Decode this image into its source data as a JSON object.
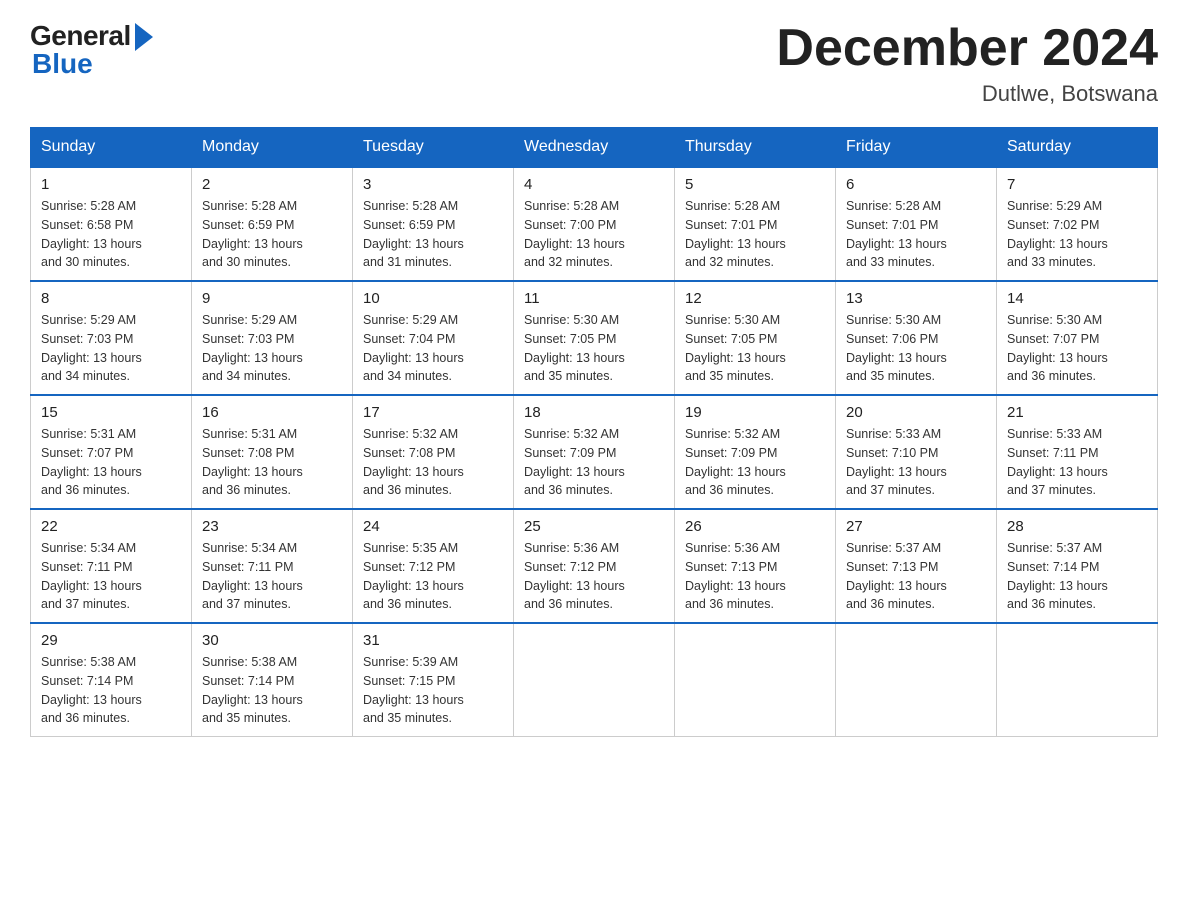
{
  "header": {
    "logo": {
      "general_text": "General",
      "blue_text": "Blue"
    },
    "title": "December 2024",
    "location": "Dutlwe, Botswana"
  },
  "days_of_week": [
    "Sunday",
    "Monday",
    "Tuesday",
    "Wednesday",
    "Thursday",
    "Friday",
    "Saturday"
  ],
  "weeks": [
    [
      {
        "day": "1",
        "sunrise": "5:28 AM",
        "sunset": "6:58 PM",
        "daylight": "13 hours and 30 minutes."
      },
      {
        "day": "2",
        "sunrise": "5:28 AM",
        "sunset": "6:59 PM",
        "daylight": "13 hours and 30 minutes."
      },
      {
        "day": "3",
        "sunrise": "5:28 AM",
        "sunset": "6:59 PM",
        "daylight": "13 hours and 31 minutes."
      },
      {
        "day": "4",
        "sunrise": "5:28 AM",
        "sunset": "7:00 PM",
        "daylight": "13 hours and 32 minutes."
      },
      {
        "day": "5",
        "sunrise": "5:28 AM",
        "sunset": "7:01 PM",
        "daylight": "13 hours and 32 minutes."
      },
      {
        "day": "6",
        "sunrise": "5:28 AM",
        "sunset": "7:01 PM",
        "daylight": "13 hours and 33 minutes."
      },
      {
        "day": "7",
        "sunrise": "5:29 AM",
        "sunset": "7:02 PM",
        "daylight": "13 hours and 33 minutes."
      }
    ],
    [
      {
        "day": "8",
        "sunrise": "5:29 AM",
        "sunset": "7:03 PM",
        "daylight": "13 hours and 34 minutes."
      },
      {
        "day": "9",
        "sunrise": "5:29 AM",
        "sunset": "7:03 PM",
        "daylight": "13 hours and 34 minutes."
      },
      {
        "day": "10",
        "sunrise": "5:29 AM",
        "sunset": "7:04 PM",
        "daylight": "13 hours and 34 minutes."
      },
      {
        "day": "11",
        "sunrise": "5:30 AM",
        "sunset": "7:05 PM",
        "daylight": "13 hours and 35 minutes."
      },
      {
        "day": "12",
        "sunrise": "5:30 AM",
        "sunset": "7:05 PM",
        "daylight": "13 hours and 35 minutes."
      },
      {
        "day": "13",
        "sunrise": "5:30 AM",
        "sunset": "7:06 PM",
        "daylight": "13 hours and 35 minutes."
      },
      {
        "day": "14",
        "sunrise": "5:30 AM",
        "sunset": "7:07 PM",
        "daylight": "13 hours and 36 minutes."
      }
    ],
    [
      {
        "day": "15",
        "sunrise": "5:31 AM",
        "sunset": "7:07 PM",
        "daylight": "13 hours and 36 minutes."
      },
      {
        "day": "16",
        "sunrise": "5:31 AM",
        "sunset": "7:08 PM",
        "daylight": "13 hours and 36 minutes."
      },
      {
        "day": "17",
        "sunrise": "5:32 AM",
        "sunset": "7:08 PM",
        "daylight": "13 hours and 36 minutes."
      },
      {
        "day": "18",
        "sunrise": "5:32 AM",
        "sunset": "7:09 PM",
        "daylight": "13 hours and 36 minutes."
      },
      {
        "day": "19",
        "sunrise": "5:32 AM",
        "sunset": "7:09 PM",
        "daylight": "13 hours and 36 minutes."
      },
      {
        "day": "20",
        "sunrise": "5:33 AM",
        "sunset": "7:10 PM",
        "daylight": "13 hours and 37 minutes."
      },
      {
        "day": "21",
        "sunrise": "5:33 AM",
        "sunset": "7:11 PM",
        "daylight": "13 hours and 37 minutes."
      }
    ],
    [
      {
        "day": "22",
        "sunrise": "5:34 AM",
        "sunset": "7:11 PM",
        "daylight": "13 hours and 37 minutes."
      },
      {
        "day": "23",
        "sunrise": "5:34 AM",
        "sunset": "7:11 PM",
        "daylight": "13 hours and 37 minutes."
      },
      {
        "day": "24",
        "sunrise": "5:35 AM",
        "sunset": "7:12 PM",
        "daylight": "13 hours and 36 minutes."
      },
      {
        "day": "25",
        "sunrise": "5:36 AM",
        "sunset": "7:12 PM",
        "daylight": "13 hours and 36 minutes."
      },
      {
        "day": "26",
        "sunrise": "5:36 AM",
        "sunset": "7:13 PM",
        "daylight": "13 hours and 36 minutes."
      },
      {
        "day": "27",
        "sunrise": "5:37 AM",
        "sunset": "7:13 PM",
        "daylight": "13 hours and 36 minutes."
      },
      {
        "day": "28",
        "sunrise": "5:37 AM",
        "sunset": "7:14 PM",
        "daylight": "13 hours and 36 minutes."
      }
    ],
    [
      {
        "day": "29",
        "sunrise": "5:38 AM",
        "sunset": "7:14 PM",
        "daylight": "13 hours and 36 minutes."
      },
      {
        "day": "30",
        "sunrise": "5:38 AM",
        "sunset": "7:14 PM",
        "daylight": "13 hours and 35 minutes."
      },
      {
        "day": "31",
        "sunrise": "5:39 AM",
        "sunset": "7:15 PM",
        "daylight": "13 hours and 35 minutes."
      },
      null,
      null,
      null,
      null
    ]
  ],
  "labels": {
    "sunrise": "Sunrise:",
    "sunset": "Sunset:",
    "daylight": "Daylight:"
  }
}
